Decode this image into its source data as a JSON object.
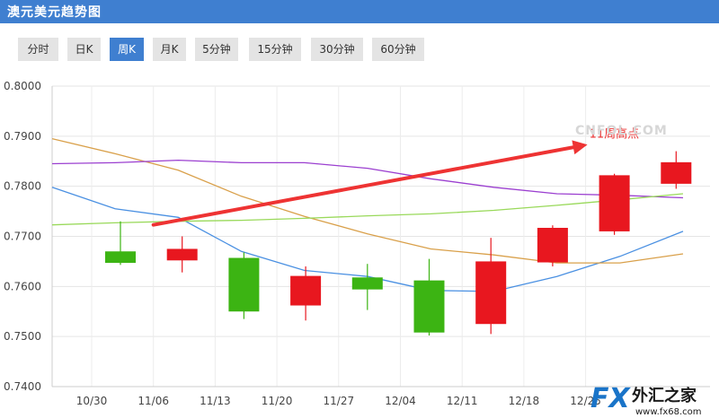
{
  "header": {
    "title": "澳元美元趋势图"
  },
  "tabs": [
    {
      "label": "分时",
      "active": false
    },
    {
      "label": "日K",
      "active": false
    },
    {
      "label": "周K",
      "active": true
    },
    {
      "label": "月K",
      "active": false
    },
    {
      "label": "5分钟",
      "active": false
    },
    {
      "label": "15分钟",
      "active": false
    },
    {
      "label": "30分钟",
      "active": false
    },
    {
      "label": "60分钟",
      "active": false
    }
  ],
  "colors": {
    "up": "#e8171f",
    "down": "#3cb413",
    "header": "#3f7fd0",
    "arrow": "#ee3333",
    "ma1": "#4a90e2",
    "ma2": "#d9a04a",
    "ma3": "#9b3fd0",
    "ma4": "#99d95a"
  },
  "watermark": {
    "cnfol": "CNFOL.COM",
    "brand_fx": "FX",
    "brand_cn": "外汇之家",
    "brand_url": "www.fx68.com"
  },
  "chart_data": {
    "type": "candlestick",
    "y_ticks": [
      "0.7400",
      "0.7500",
      "0.7600",
      "0.7700",
      "0.7800",
      "0.7900",
      "0.8000"
    ],
    "ylim": [
      0.74,
      0.8
    ],
    "x_ticks": [
      "10/30",
      "11/06",
      "11/13",
      "11/20",
      "11/27",
      "12/04",
      "12/11",
      "12/18",
      "12/25"
    ],
    "candles": [
      {
        "open": 0.767,
        "high": 0.773,
        "low": 0.7643,
        "close": 0.7647
      },
      {
        "open": 0.7652,
        "high": 0.77,
        "low": 0.7628,
        "close": 0.7675
      },
      {
        "open": 0.7657,
        "high": 0.7668,
        "low": 0.7535,
        "close": 0.755
      },
      {
        "open": 0.7562,
        "high": 0.764,
        "low": 0.7532,
        "close": 0.7621
      },
      {
        "open": 0.7618,
        "high": 0.7645,
        "low": 0.7553,
        "close": 0.7594
      },
      {
        "open": 0.7612,
        "high": 0.7655,
        "low": 0.7502,
        "close": 0.7508
      },
      {
        "open": 0.7525,
        "high": 0.7697,
        "low": 0.7505,
        "close": 0.765
      },
      {
        "open": 0.7648,
        "high": 0.7722,
        "low": 0.764,
        "close": 0.7717
      },
      {
        "open": 0.771,
        "high": 0.7825,
        "low": 0.7703,
        "close": 0.7822
      },
      {
        "open": 0.7805,
        "high": 0.787,
        "low": 0.7795,
        "close": 0.7848
      }
    ],
    "moving_averages": [
      {
        "color": "#4a90e2",
        "values": [
          0.7798,
          0.7755,
          0.7738,
          0.767,
          0.7632,
          0.762,
          0.7592,
          0.759,
          0.762,
          0.766,
          0.771
        ]
      },
      {
        "color": "#d9a04a",
        "values": [
          0.7895,
          0.7865,
          0.7832,
          0.778,
          0.774,
          0.7705,
          0.7675,
          0.7663,
          0.7647,
          0.7647,
          0.7665
        ]
      },
      {
        "color": "#9b3fd0",
        "values": [
          0.7845,
          0.7847,
          0.7852,
          0.7847,
          0.7847,
          0.7836,
          0.7815,
          0.7798,
          0.7785,
          0.7782,
          0.7777
        ]
      },
      {
        "color": "#99d95a",
        "values": [
          0.7723,
          0.7727,
          0.773,
          0.7732,
          0.7736,
          0.7741,
          0.7745,
          0.7752,
          0.7762,
          0.7773,
          0.7785
        ]
      }
    ],
    "annotation": {
      "text": "11周高点",
      "from": {
        "x": "11/06",
        "y": 0.7723
      },
      "to": {
        "x": "12/25",
        "y": 0.7883
      }
    }
  }
}
